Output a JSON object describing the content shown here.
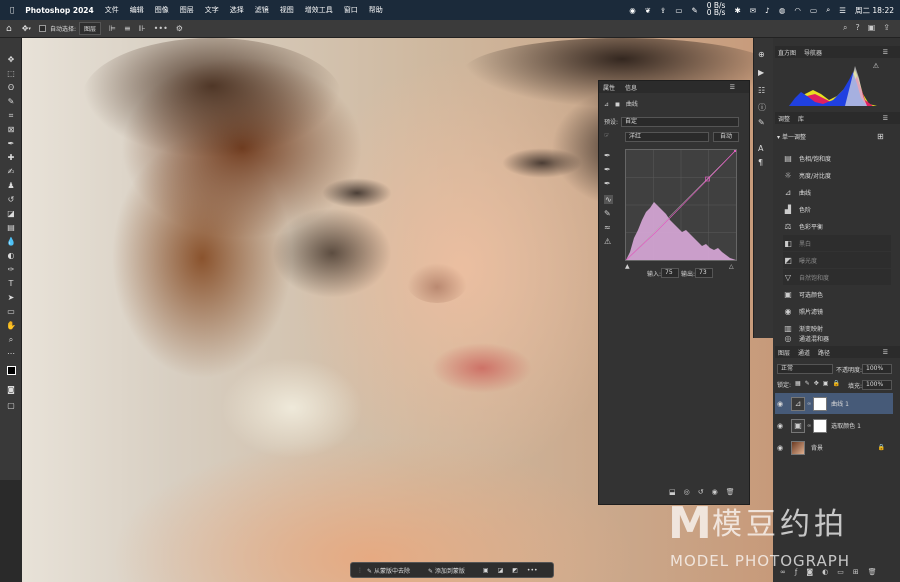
{
  "menubar": {
    "apple_icon": "apple-logo",
    "app_name": "Photoshop 2024",
    "items": [
      "文件",
      "编辑",
      "图像",
      "图层",
      "文字",
      "选择",
      "滤镜",
      "视图",
      "增效工具",
      "窗口",
      "帮助"
    ],
    "status": {
      "net_up": "0 B/s",
      "net_down": "0 B/s",
      "clock": "周二 18:22"
    }
  },
  "options": {
    "auto_select_label": "自动选择:",
    "auto_select_value": "图层",
    "more": "•••"
  },
  "properties": {
    "tabs": [
      "属性",
      "信息"
    ],
    "section_title": "曲线",
    "preset_label": "预设:",
    "preset_value": "自定",
    "channel_value": "洋红",
    "auto_button": "自动",
    "input_label": "输入:",
    "input_value": "75",
    "output_label": "输出:",
    "output_value": "73",
    "curve_color": "#d88ad8"
  },
  "histogram_panel": {
    "tabs": [
      "直方图",
      "导航器"
    ]
  },
  "adjustments_panel": {
    "tabs": [
      "调整",
      "库"
    ],
    "group_title": "单一调整",
    "items": [
      {
        "label": "色相/饱和度",
        "dim": false
      },
      {
        "label": "亮度/对比度",
        "dim": false
      },
      {
        "label": "曲线",
        "dim": false
      },
      {
        "label": "色阶",
        "dim": false
      },
      {
        "label": "色彩平衡",
        "dim": false
      },
      {
        "label": "黑白",
        "dim": true
      },
      {
        "label": "曝光度",
        "dim": true
      },
      {
        "label": "自然饱和度",
        "dim": true
      },
      {
        "label": "可选颜色",
        "dim": false
      },
      {
        "label": "照片滤镜",
        "dim": false
      },
      {
        "label": "渐变映射",
        "dim": false
      },
      {
        "label": "通道混和器",
        "dim": false
      }
    ]
  },
  "layers_panel": {
    "tabs": [
      "图层",
      "通道",
      "路径"
    ],
    "blend_mode": "正常",
    "opacity_label": "不透明度:",
    "opacity_value": "100%",
    "lock_label": "锁定:",
    "fill_label": "填充:",
    "fill_value": "100%",
    "layers": [
      {
        "name": "曲线 1",
        "selected": true
      },
      {
        "name": "选取颜色 1",
        "selected": false
      },
      {
        "name": "背景",
        "selected": false
      }
    ]
  },
  "taskbar": {
    "remove_from_mask": "从蒙版中去除",
    "add_to_mask": "添加到蒙版",
    "more": "•••"
  },
  "watermark": {
    "brand_cn": "模豆约拍",
    "brand_en": "MODEL PHOTOGRAPH"
  }
}
